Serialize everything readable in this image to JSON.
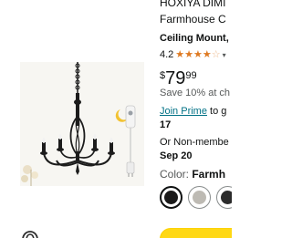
{
  "product": {
    "title_line1": "HOXIYA DIMI",
    "title_line2": "Farmhouse C",
    "subtitle": "Ceiling Mount,",
    "rating_value": "4.2",
    "rating_stars": 4.2,
    "price_symbol": "$",
    "price_whole": "79",
    "price_fraction": "99",
    "save_text": "Save 10% at ch",
    "prime_link": "Join Prime",
    "prime_rest": " to g",
    "prime_date": "17",
    "nonmember_text": "Or Non-membe",
    "nonmember_date": "Sep 20",
    "color_label": "Color: ",
    "color_value": "Farmh"
  },
  "swatches": [
    {
      "name": "black",
      "color": "#1a1a1a",
      "selected": true
    },
    {
      "name": "gray",
      "color": "#bdbab3",
      "selected": false
    },
    {
      "name": "dark",
      "color": "#2b2b2b",
      "selected": false
    }
  ],
  "colors": {
    "star": "#de7921",
    "link": "#007185",
    "buy_button": "#ffd814"
  },
  "icons": {
    "zoom": "zoom-gesture-icon",
    "rating_dropdown": "chevron-down-icon"
  }
}
